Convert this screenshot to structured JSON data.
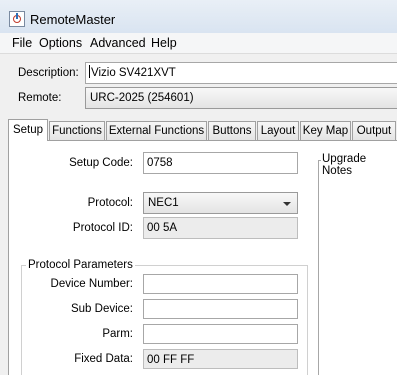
{
  "window": {
    "title": "RemoteMaster"
  },
  "menu": [
    "File",
    "Options",
    "Advanced",
    "Help"
  ],
  "description": {
    "label": "Description:",
    "value": "Vizio SV421XVT"
  },
  "remote": {
    "label": "Remote:",
    "value": "URC-2025 (254601)"
  },
  "tabs": [
    "Setup",
    "Functions",
    "External Functions",
    "Buttons",
    "Layout",
    "Key Map",
    "Output"
  ],
  "setup": {
    "setup_code": {
      "label": "Setup Code:",
      "value": "0758"
    },
    "protocol": {
      "label": "Protocol:",
      "value": "NEC1"
    },
    "protocol_id": {
      "label": "Protocol ID:",
      "value": "00 5A"
    },
    "params_title": "Protocol Parameters",
    "device_number": {
      "label": "Device Number:",
      "value": ""
    },
    "sub_device": {
      "label": "Sub Device:",
      "value": ""
    },
    "parm": {
      "label": "Parm:",
      "value": ""
    },
    "fixed_data": {
      "label": "Fixed Data:",
      "value": "00 FF FF"
    }
  },
  "upgrade_notes": {
    "title": "Upgrade Notes"
  }
}
